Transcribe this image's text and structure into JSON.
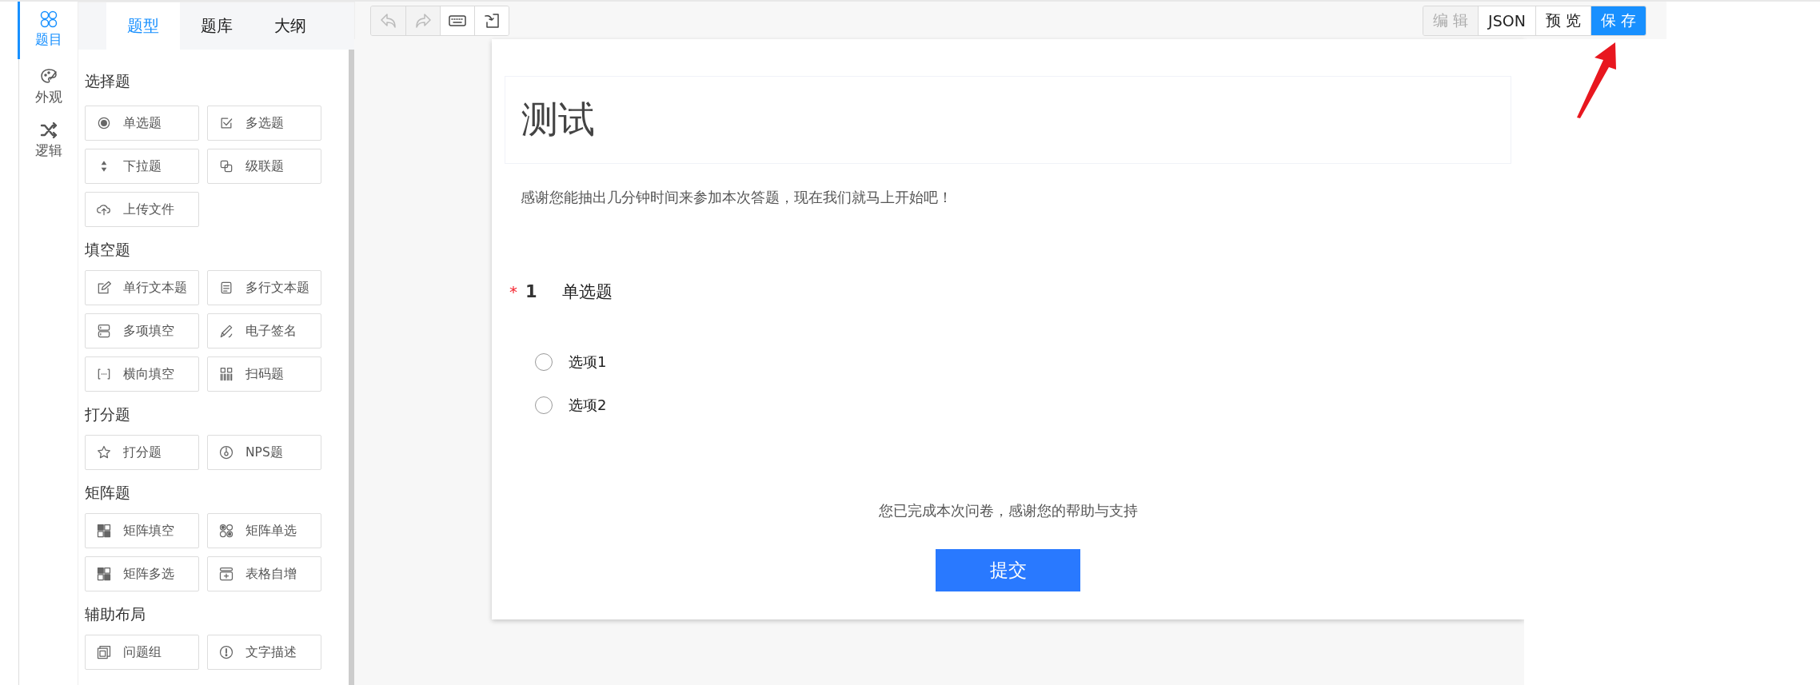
{
  "rail": [
    {
      "label": "题目",
      "kind": "question",
      "selected": true
    },
    {
      "label": "外观",
      "kind": "palette",
      "selected": false
    },
    {
      "label": "逻辑",
      "kind": "shuffle",
      "selected": false
    }
  ],
  "panel_tabs": [
    {
      "label": "题型",
      "selected": true
    },
    {
      "label": "题库",
      "selected": false
    },
    {
      "label": "大纲",
      "selected": false
    }
  ],
  "sections": [
    {
      "title": "选择题",
      "items": [
        {
          "label": "单选题",
          "kind": "radio"
        },
        {
          "label": "多选题",
          "kind": "checkbox"
        },
        {
          "label": "下拉题",
          "kind": "dropdown"
        },
        {
          "label": "级联题",
          "kind": "cascade"
        },
        {
          "label": "上传文件",
          "kind": "upload"
        }
      ]
    },
    {
      "title": "填空题",
      "items": [
        {
          "label": "单行文本题",
          "kind": "text"
        },
        {
          "label": "多行文本题",
          "kind": "textarea"
        },
        {
          "label": "多项填空",
          "kind": "multifill"
        },
        {
          "label": "电子签名",
          "kind": "signature"
        },
        {
          "label": "横向填空",
          "kind": "inline"
        },
        {
          "label": "扫码题",
          "kind": "scan"
        }
      ]
    },
    {
      "title": "打分题",
      "items": [
        {
          "label": "打分题",
          "kind": "star"
        },
        {
          "label": "NPS题",
          "kind": "nps"
        }
      ]
    },
    {
      "title": "矩阵题",
      "items": [
        {
          "label": "矩阵填空",
          "kind": "matrixfill"
        },
        {
          "label": "矩阵单选",
          "kind": "matrixradio"
        },
        {
          "label": "矩阵多选",
          "kind": "matrixcheck"
        },
        {
          "label": "表格自增",
          "kind": "table"
        }
      ]
    },
    {
      "title": "辅助布局",
      "items": [
        {
          "label": "问题组",
          "kind": "group"
        },
        {
          "label": "文字描述",
          "kind": "info"
        }
      ]
    }
  ],
  "toolbar": [
    {
      "kind": "undo",
      "disabled": true
    },
    {
      "kind": "redo",
      "disabled": true
    },
    {
      "kind": "keyboard",
      "disabled": false
    },
    {
      "kind": "import",
      "disabled": false
    }
  ],
  "mode_buttons": [
    {
      "label": "编 辑",
      "disabled": true,
      "primary": false
    },
    {
      "label": "JSON",
      "disabled": false,
      "primary": false
    },
    {
      "label": "预 览",
      "disabled": false,
      "primary": false
    },
    {
      "label": "保 存",
      "disabled": false,
      "primary": true
    }
  ],
  "survey": {
    "title": "测试",
    "description": "感谢您能抽出几分钟时间来参加本次答题，现在我们就马上开始吧！",
    "questions": [
      {
        "required_mark": "*",
        "number": "1",
        "title": "单选题",
        "options": [
          {
            "label": "选项1",
            "selected": false
          },
          {
            "label": "选项2",
            "selected": false
          }
        ]
      }
    ],
    "completion": "您已完成本次问卷，感谢您的帮助与支持",
    "submit": "提交"
  }
}
